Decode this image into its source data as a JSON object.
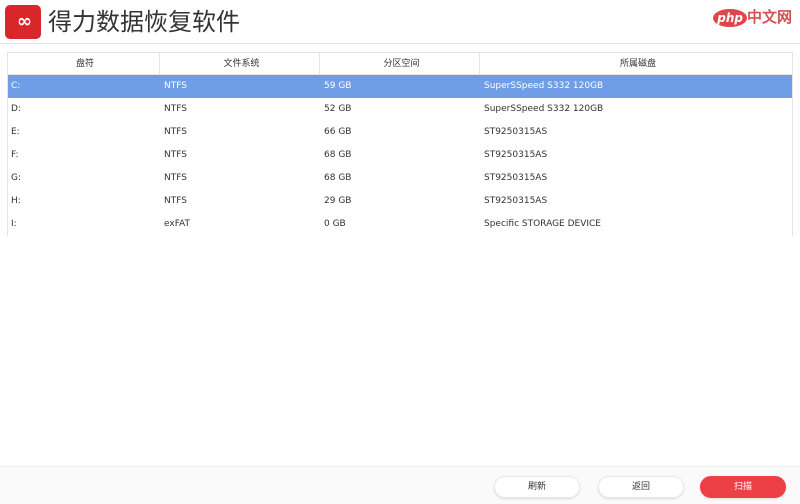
{
  "app": {
    "logo": "∞",
    "title": "得力数据恢复软件",
    "watermark_logo": "php",
    "watermark_text": "中文网"
  },
  "table": {
    "headers": [
      "盘符",
      "文件系统",
      "分区空间",
      "所属磁盘"
    ],
    "rows": [
      [
        "C:",
        "NTFS",
        "59 GB",
        "SuperSSpeed S332 120GB"
      ],
      [
        "D:",
        "NTFS",
        "52 GB",
        "SuperSSpeed S332 120GB"
      ],
      [
        "E:",
        "NTFS",
        "66 GB",
        "ST9250315AS"
      ],
      [
        "F:",
        "NTFS",
        "68 GB",
        "ST9250315AS"
      ],
      [
        "G:",
        "NTFS",
        "68 GB",
        "ST9250315AS"
      ],
      [
        "H:",
        "NTFS",
        "29 GB",
        "ST9250315AS"
      ],
      [
        "I:",
        "exFAT",
        "0 GB",
        "Specific STORAGE DEVICE"
      ]
    ],
    "selected_index": 0
  },
  "buttons": {
    "refresh": "刷新",
    "back": "返回",
    "scan": "扫描"
  },
  "colors": {
    "brand": "#d9262b",
    "selected": "#6f9de6",
    "scan": "#ec4046"
  }
}
